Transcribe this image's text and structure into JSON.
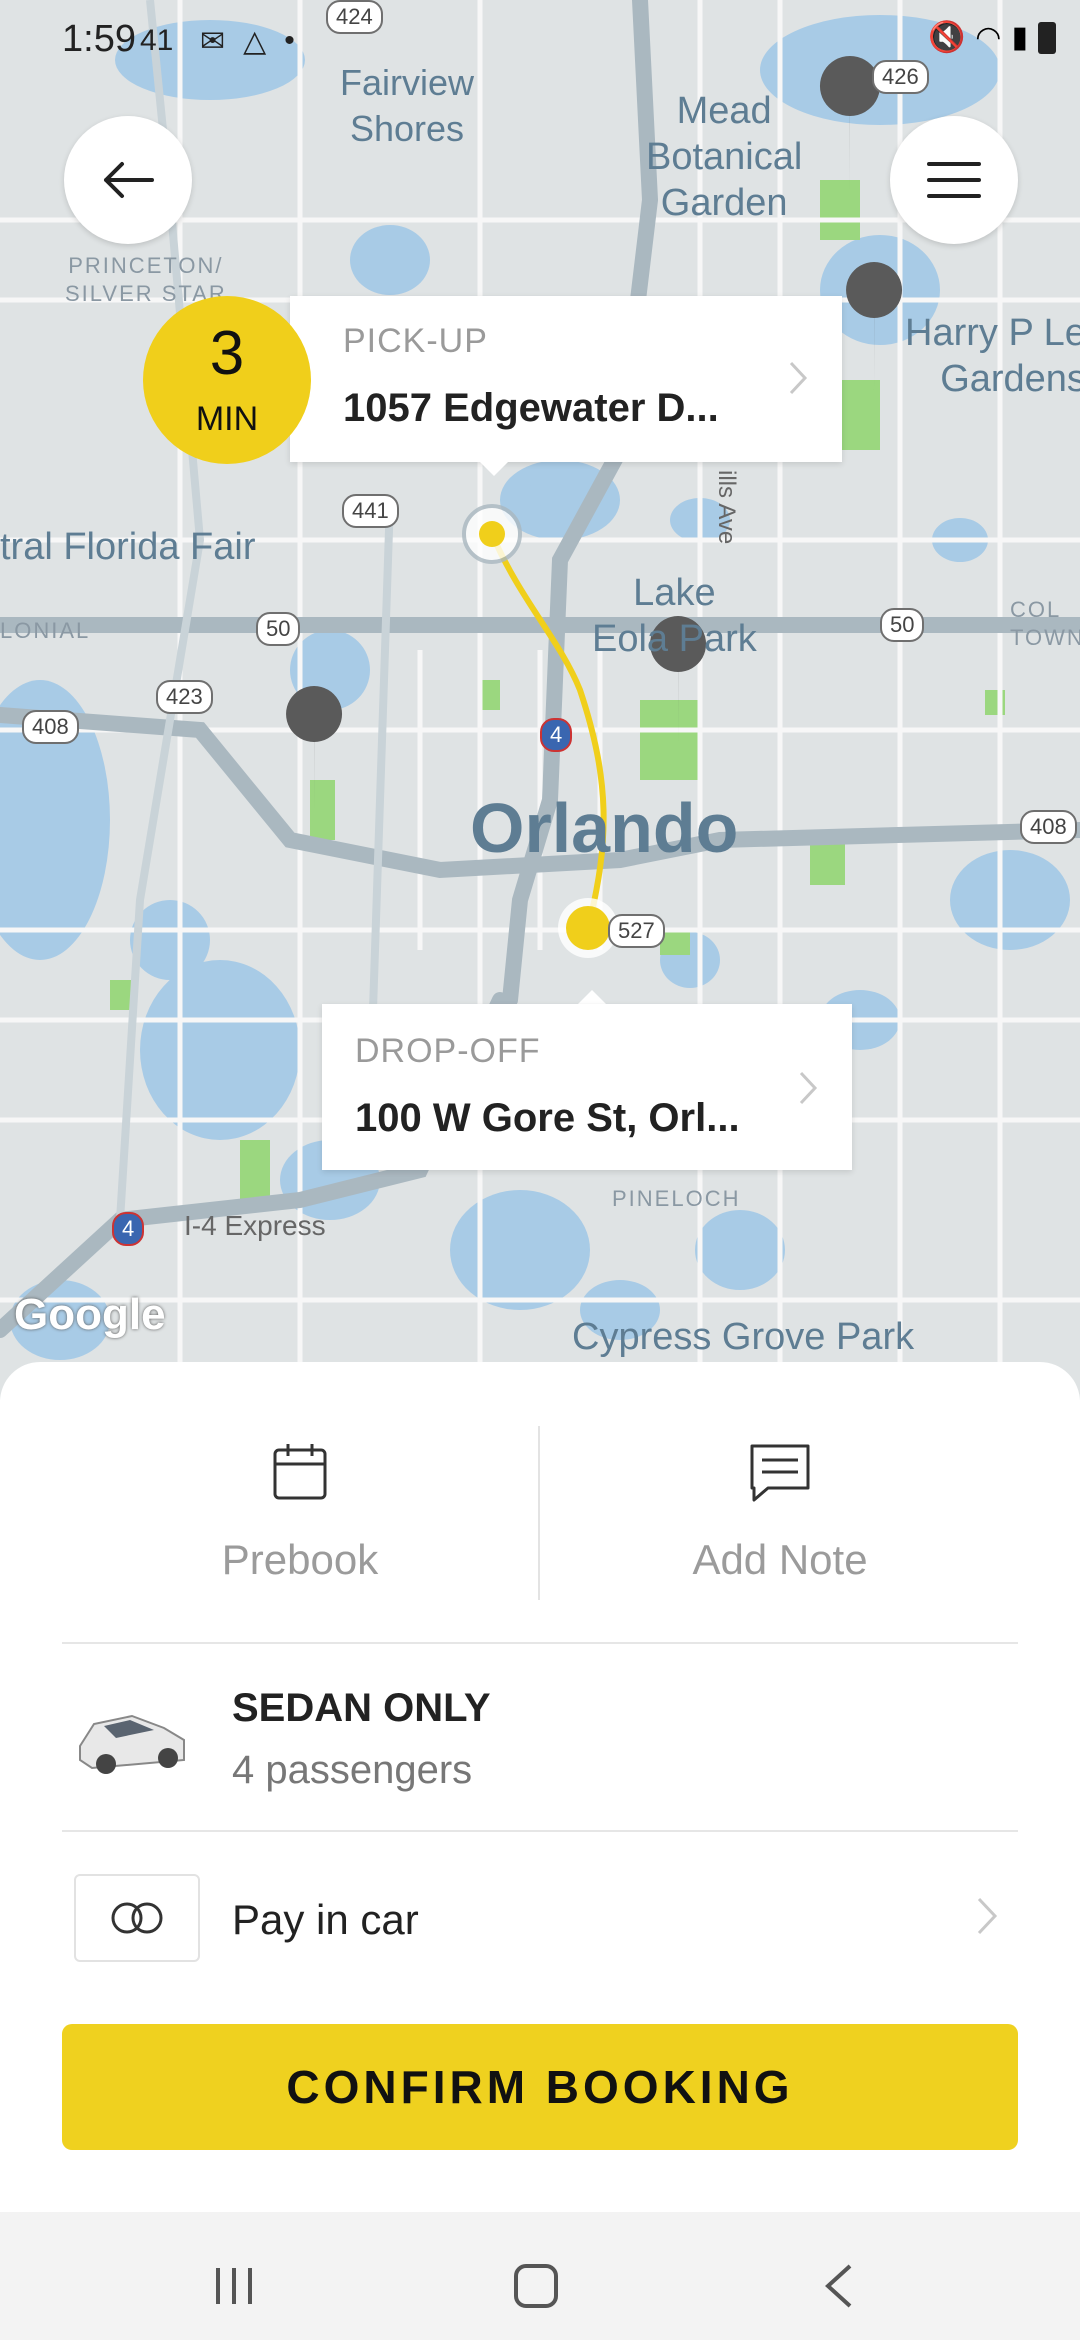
{
  "status_bar": {
    "time": "1:59",
    "badge": "41"
  },
  "map": {
    "labels": {
      "fairview_shores": "Fairview\nShores",
      "mead_garden": "Mead\nBotanical\nGarden",
      "princeton": "PRINCETON/\nSILVER STAR",
      "harry_p": "Harry P Le\nGardens",
      "florida_fair": "tral Florida Fair",
      "lake_eola": "Lake\nEola Park",
      "colonial": "LONIAL",
      "col_town": "COL\nTOWN",
      "orlando": "Orlando",
      "pineloch": "PINELOCH",
      "i4_express": "I-4 Express",
      "cypress_grove": "Cypress Grove Park",
      "google": "Google",
      "mills_ave": "ills Ave"
    },
    "shields": [
      "424",
      "426",
      "441",
      "50",
      "50",
      "423",
      "408",
      "408",
      "4",
      "527",
      "4"
    ]
  },
  "eta": {
    "value": "3",
    "unit": "MIN"
  },
  "pickup": {
    "label": "PICK-UP",
    "address": "1057 Edgewater D..."
  },
  "dropoff": {
    "label": "DROP-OFF",
    "address": "100 W Gore St, Orl..."
  },
  "actions": {
    "prebook": "Prebook",
    "add_note": "Add Note"
  },
  "vehicle": {
    "title": "SEDAN ONLY",
    "subtitle": "4 passengers"
  },
  "payment": {
    "label": "Pay in car"
  },
  "confirm_button": "CONFIRM BOOKING",
  "colors": {
    "accent": "#efd11f",
    "route": "#f0cf1b",
    "water": "#a8cbe6",
    "park": "#9bd77f"
  }
}
